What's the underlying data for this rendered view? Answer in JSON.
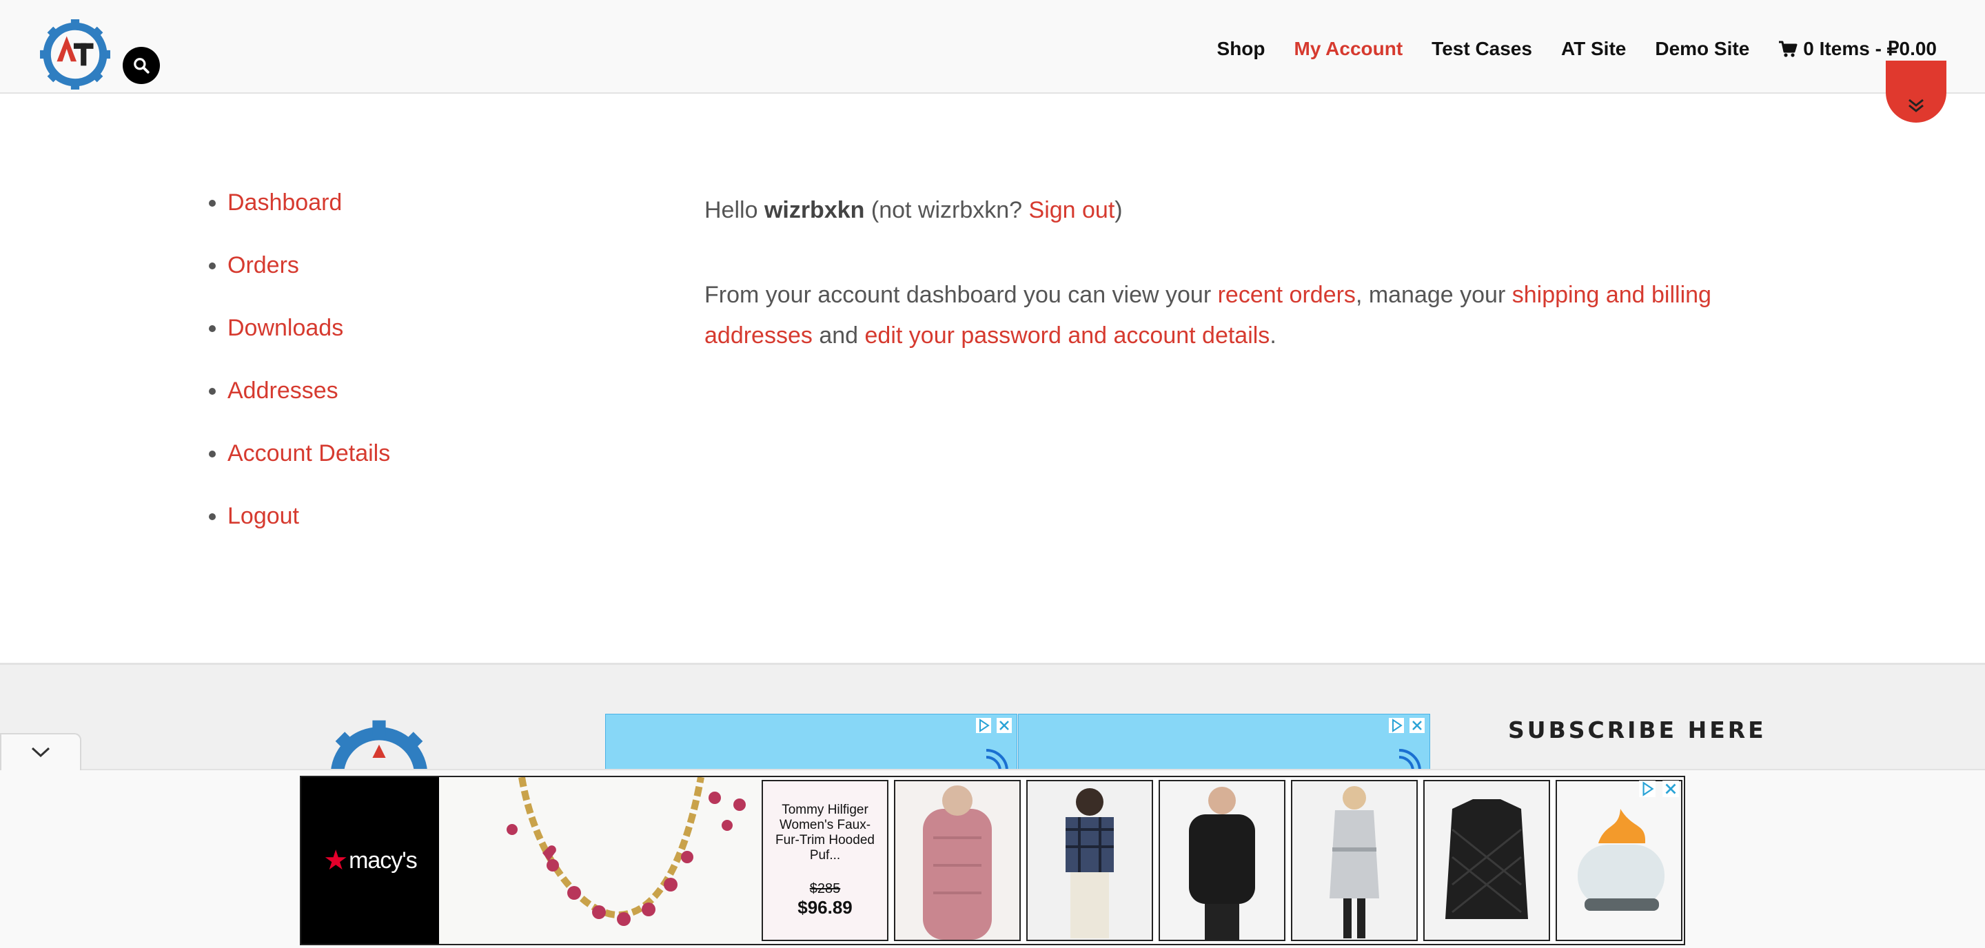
{
  "header": {
    "nav": [
      "Shop",
      "My Account",
      "Test Cases",
      "AT Site",
      "Demo Site"
    ],
    "active_index": 1,
    "cart_label": "0 Items - ₽0.00",
    "accent_color": "#d63a2f"
  },
  "account_nav": [
    "Dashboard",
    "Orders",
    "Downloads",
    "Addresses",
    "Account Details",
    "Logout"
  ],
  "dashboard": {
    "hello": "Hello",
    "username": "wizrbxkn",
    "not_user": "(not wizrbxkn?",
    "sign_out": "Sign out",
    "close_paren": ")",
    "intro": "From your account dashboard you can view your",
    "recent_orders": "recent orders",
    "manage": ", manage your",
    "addresses_link": "shipping and billing addresses",
    "and": "and",
    "account_link": "edit your password and account details",
    "period": "."
  },
  "footer": {
    "subscribe": "SUBSCRIBE HERE"
  },
  "ad": {
    "brand": "macy's",
    "product_name": "Tommy Hilfiger Women's Faux-Fur-Trim Hooded Puf...",
    "old_price": "$285",
    "new_price": "$96.89"
  }
}
